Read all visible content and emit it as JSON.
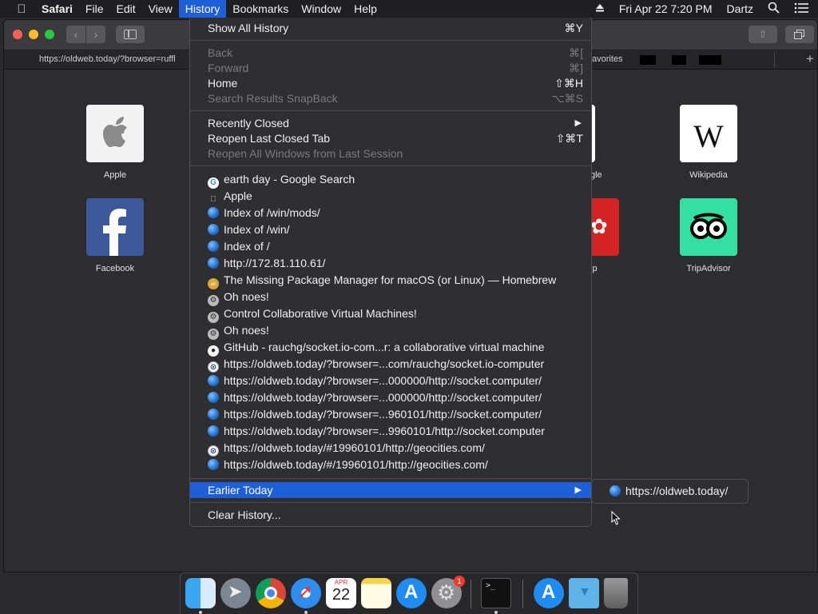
{
  "menubar": {
    "app": "Safari",
    "items": [
      "File",
      "Edit",
      "View",
      "History",
      "Bookmarks",
      "Window",
      "Help"
    ],
    "active": "History",
    "clock": "Fri Apr 22  7:20 PM",
    "user": "Dartz",
    "icons": [
      "apple-icon",
      "eject-icon",
      "spotlight-search-icon",
      "notification-list-icon"
    ]
  },
  "window": {
    "tab_url": "https://oldweb.today/?browser=ruffl",
    "tab_favorites": "avorites",
    "new_tab": "+"
  },
  "favorites": [
    {
      "label": "Apple",
      "icon": "apple-logo-icon"
    },
    {
      "label": "Facebook",
      "icon": "facebook-logo-icon"
    },
    {
      "label": "gle",
      "icon": "google-logo-icon"
    },
    {
      "label": "lp",
      "icon": "yelp-logo-icon"
    },
    {
      "label": "Wikipedia",
      "icon": "wikipedia-logo-icon"
    },
    {
      "label": "TripAdvisor",
      "icon": "tripadvisor-logo-icon"
    }
  ],
  "history_menu": {
    "show_all": {
      "label": "Show All History",
      "shortcut": "⌘Y"
    },
    "back": {
      "label": "Back",
      "shortcut": "⌘["
    },
    "forward": {
      "label": "Forward",
      "shortcut": "⌘]"
    },
    "home": {
      "label": "Home",
      "shortcut": "⇧⌘H"
    },
    "snapback": {
      "label": "Search Results SnapBack",
      "shortcut": "⌥⌘S"
    },
    "recently_closed": {
      "label": "Recently Closed"
    },
    "reopen_tab": {
      "label": "Reopen Last Closed Tab",
      "shortcut": "⇧⌘T"
    },
    "reopen_windows": {
      "label": "Reopen All Windows from Last Session"
    },
    "entries": [
      {
        "label": "earth day - Google Search",
        "icon": "google"
      },
      {
        "label": "Apple",
        "icon": "apple"
      },
      {
        "label": "Index of /win/mods/",
        "icon": "globe"
      },
      {
        "label": "Index of /win/",
        "icon": "globe"
      },
      {
        "label": "Index of /",
        "icon": "globe"
      },
      {
        "label": "http://172.81.110.61/",
        "icon": "globe"
      },
      {
        "label": "The Missing Package Manager for macOS (or Linux) — Homebrew",
        "icon": "brew"
      },
      {
        "label": "Oh noes!",
        "icon": "vm"
      },
      {
        "label": "Control Collaborative Virtual Machines!",
        "icon": "vm"
      },
      {
        "label": "Oh noes!",
        "icon": "vm"
      },
      {
        "label": "GitHub - rauchg/socket.io-com...r: a collaborative virtual machine",
        "icon": "github"
      },
      {
        "label": "https://oldweb.today/?browser=...com/rauchg/socket.io-computer",
        "icon": "oldweb"
      },
      {
        "label": "https://oldweb.today/?browser=...000000/http://socket.computer/",
        "icon": "globe"
      },
      {
        "label": "https://oldweb.today/?browser=...000000/http://socket.computer/",
        "icon": "globe"
      },
      {
        "label": "https://oldweb.today/?browser=...960101/http://socket.computer/",
        "icon": "globe"
      },
      {
        "label": "https://oldweb.today/?browser=...9960101/http://socket.computer",
        "icon": "globe"
      },
      {
        "label": "https://oldweb.today/#19960101/http://geocities.com/",
        "icon": "oldweb"
      },
      {
        "label": "https://oldweb.today/#/19960101/http://geocities.com/",
        "icon": "globe"
      }
    ],
    "earlier_today": {
      "label": "Earlier Today"
    },
    "clear_history": {
      "label": "Clear History..."
    }
  },
  "submenu": {
    "label": "https://oldweb.today/"
  },
  "dock": {
    "items": [
      {
        "name": "finder-icon",
        "running": true
      },
      {
        "name": "launchpad-icon",
        "running": false
      },
      {
        "name": "chrome-icon",
        "running": false
      },
      {
        "name": "safari-icon",
        "running": true
      },
      {
        "name": "calendar-icon",
        "running": false,
        "month": "APR",
        "day": "22"
      },
      {
        "name": "notes-icon",
        "running": false
      },
      {
        "name": "app-store-icon",
        "running": false
      },
      {
        "name": "system-preferences-icon",
        "running": false,
        "badge": "1"
      },
      {
        "name": "terminal-icon",
        "running": true
      },
      {
        "name": "applications-folder-icon",
        "running": false
      },
      {
        "name": "downloads-folder-icon",
        "running": false
      },
      {
        "name": "trash-icon",
        "running": false
      }
    ]
  },
  "colors": {
    "menu_highlight": "#1d5fd6",
    "menu_background": "#2f2f31",
    "disabled_text": "#7a7a7c"
  }
}
